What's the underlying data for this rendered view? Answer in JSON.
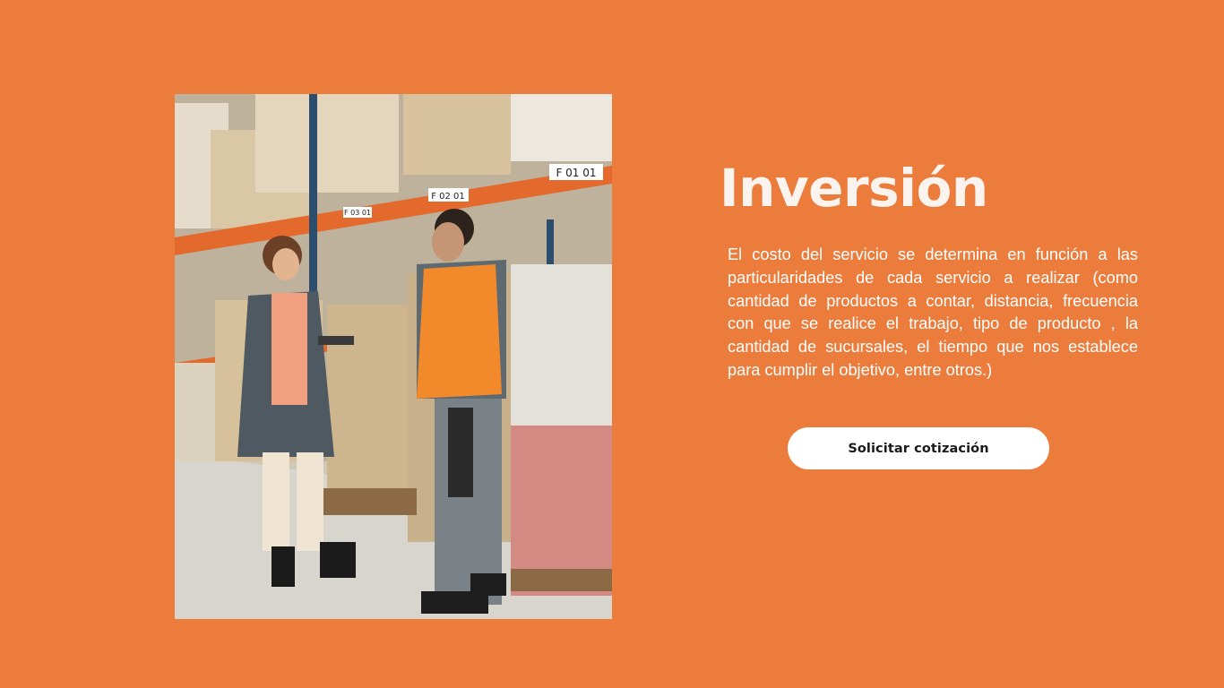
{
  "section": {
    "title": "Inversión",
    "description": "El costo del servicio  se determina en función a las particularidades de cada servicio a realizar (como cantidad de productos a contar, distancia, frecuencia con que se realice el trabajo, tipo de producto , la cantidad de sucursales, el tiempo que nos establece para cumplir el objetivo, entre otros.)",
    "cta_label": "Solicitar cotización"
  },
  "photo": {
    "shelf_labels": [
      "F 01 01",
      "F 02 01",
      "F 03 01"
    ]
  },
  "colors": {
    "background": "#EC7C3C",
    "title": "#FBF3EE",
    "text": "#FFFFFF",
    "button_bg": "#FFFFFF",
    "button_text": "#1a1a1a"
  }
}
